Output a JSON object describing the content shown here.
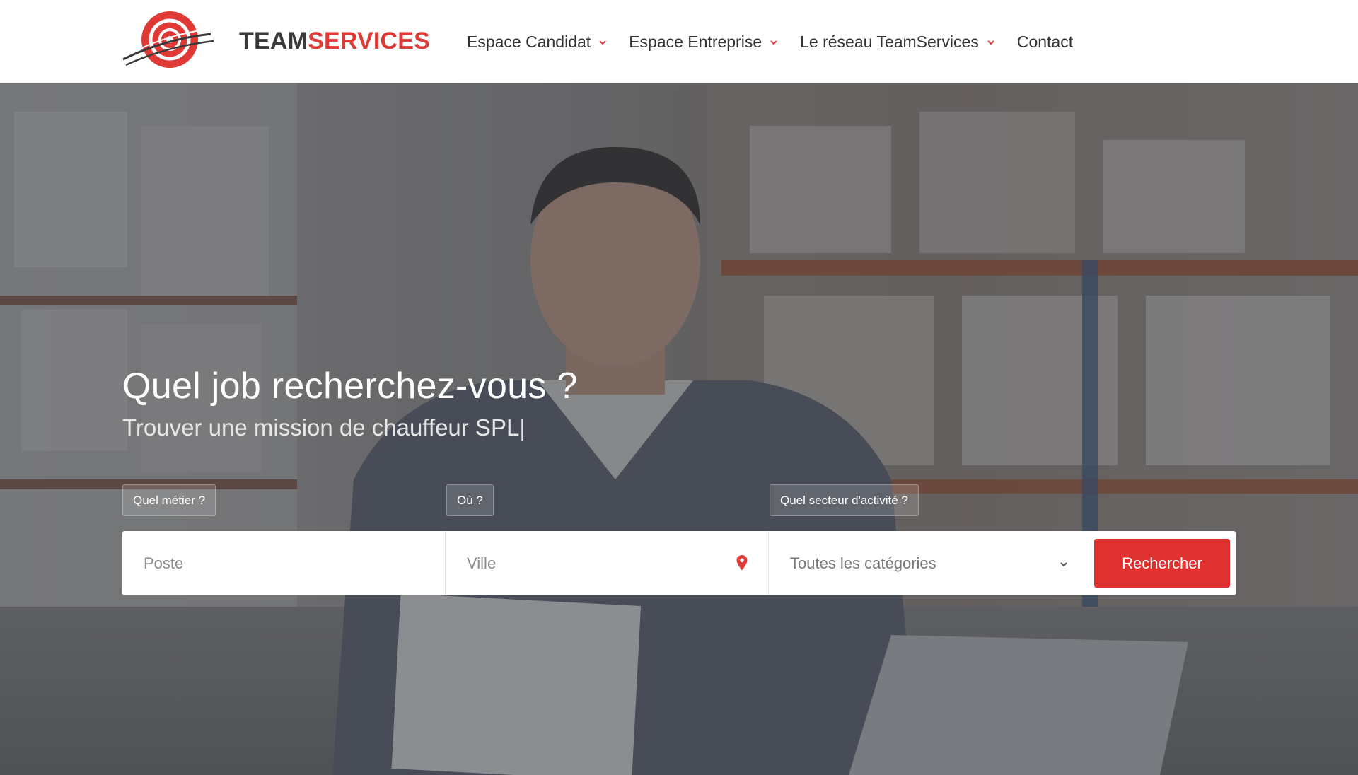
{
  "brand": {
    "name_part1": "TEAM",
    "name_part2": "SERVICES",
    "color_primary": "#e03a36",
    "color_dark": "#3a3a3a",
    "logo_icon": "teamservices-logo-icon"
  },
  "nav": {
    "items": [
      {
        "label": "Espace Candidat",
        "has_dropdown": true,
        "icon": "chevron-down-icon"
      },
      {
        "label": "Espace Entreprise",
        "has_dropdown": true,
        "icon": "chevron-down-icon"
      },
      {
        "label": "Le réseau TeamServices",
        "has_dropdown": true,
        "icon": "chevron-down-icon"
      },
      {
        "label": "Contact",
        "has_dropdown": false
      }
    ]
  },
  "hero": {
    "title": "Quel job recherchez-vous ?",
    "subtitle": "Trouver une mission de chauffeur SPL",
    "subtitle_caret": "|",
    "background": "warehouse-worker-photo"
  },
  "search": {
    "labels": {
      "metier": "Quel métier ?",
      "ou": "Où ?",
      "secteur": "Quel secteur d'activité ?"
    },
    "poste": {
      "value": "",
      "placeholder": "Poste"
    },
    "ville": {
      "value": "",
      "placeholder": "Ville",
      "icon": "map-pin-icon"
    },
    "categorie": {
      "selected": "Toutes les catégories",
      "icon": "chevron-down-icon"
    },
    "button_label": "Rechercher",
    "button_color": "#e03131"
  }
}
